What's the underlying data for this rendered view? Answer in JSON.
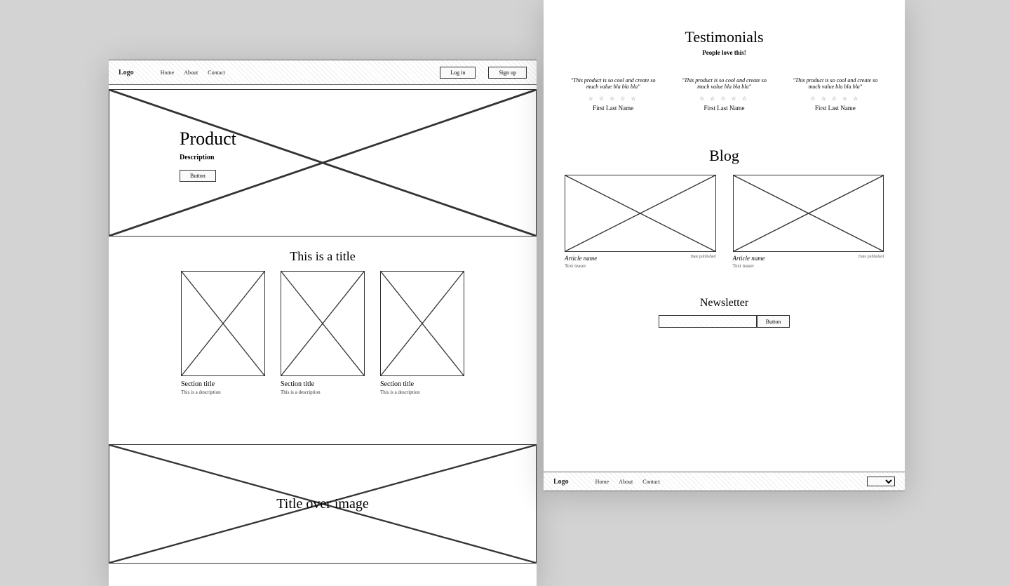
{
  "header": {
    "logo": "Logo",
    "nav": [
      "Home",
      "About",
      "Contact"
    ],
    "login": "Log in",
    "signup": "Sign up"
  },
  "hero": {
    "title": "Product",
    "description": "Description",
    "button": "Button"
  },
  "features": {
    "title": "This is a title",
    "cards": [
      {
        "title": "Section title",
        "desc": "This is a description"
      },
      {
        "title": "Section title",
        "desc": "This is a description"
      },
      {
        "title": "Section title",
        "desc": "This is a description"
      }
    ]
  },
  "banner": {
    "title": "Title over image"
  },
  "testimonials": {
    "title": "Testimonials",
    "subtitle": "People love this!",
    "items": [
      {
        "quote": "\"This product is so cool and create so much value bla bla bla\"",
        "name": "First Last Name"
      },
      {
        "quote": "\"This product is so cool and create so much value bla bla bla\"",
        "name": "First Last Name"
      },
      {
        "quote": "\"This product is so cool and create so much value bla bla bla\"",
        "name": "First Last Name"
      }
    ],
    "star_glyph": "☆ ☆ ☆ ☆ ☆"
  },
  "blog": {
    "title": "Blog",
    "posts": [
      {
        "name": "Article name",
        "date": "Date published",
        "teaser": "Text teaser"
      },
      {
        "name": "Article name",
        "date": "Date published",
        "teaser": "Text teaser"
      }
    ]
  },
  "newsletter": {
    "title": "Newsletter",
    "button": "Button"
  },
  "footer": {
    "logo": "Logo",
    "nav": [
      "Home",
      "About",
      "Contact"
    ]
  }
}
